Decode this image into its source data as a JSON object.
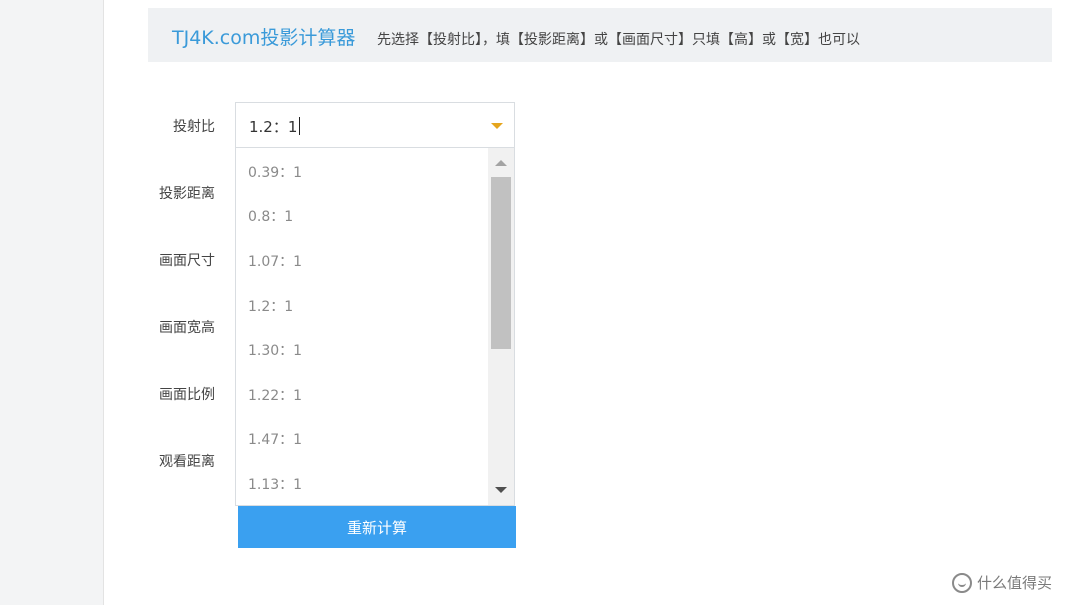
{
  "header": {
    "brand": "TJ4K.com投影计算器",
    "instructions": "先选择【投射比】，填【投影距离】或【画面尺寸】只填【高】或【宽】也可以"
  },
  "form": {
    "labels": [
      "投射比",
      "投影距离",
      "画面尺寸",
      "画面宽高",
      "画面比例",
      "观看距离"
    ],
    "throw_ratio_value": "1.2：1",
    "throw_ratio_options": [
      "0.39：1",
      "0.8：1",
      "1.07：1",
      "1.2：1",
      "1.30：1",
      "1.22：1",
      "1.47：1",
      "1.13：1"
    ],
    "recalc_label": "重新计算"
  },
  "watermark": {
    "text": "什么值得买"
  },
  "colors": {
    "brand": "#3a9ad9",
    "accent_arrow": "#e5a51d",
    "button": "#3aa0f0",
    "header_bg": "#eff1f3"
  },
  "icons": {
    "dropdown": "chevron-down-icon",
    "scroll_up": "scroll-up-arrow-icon",
    "scroll_down": "scroll-down-arrow-icon",
    "watermark": "smile-logo-icon"
  }
}
